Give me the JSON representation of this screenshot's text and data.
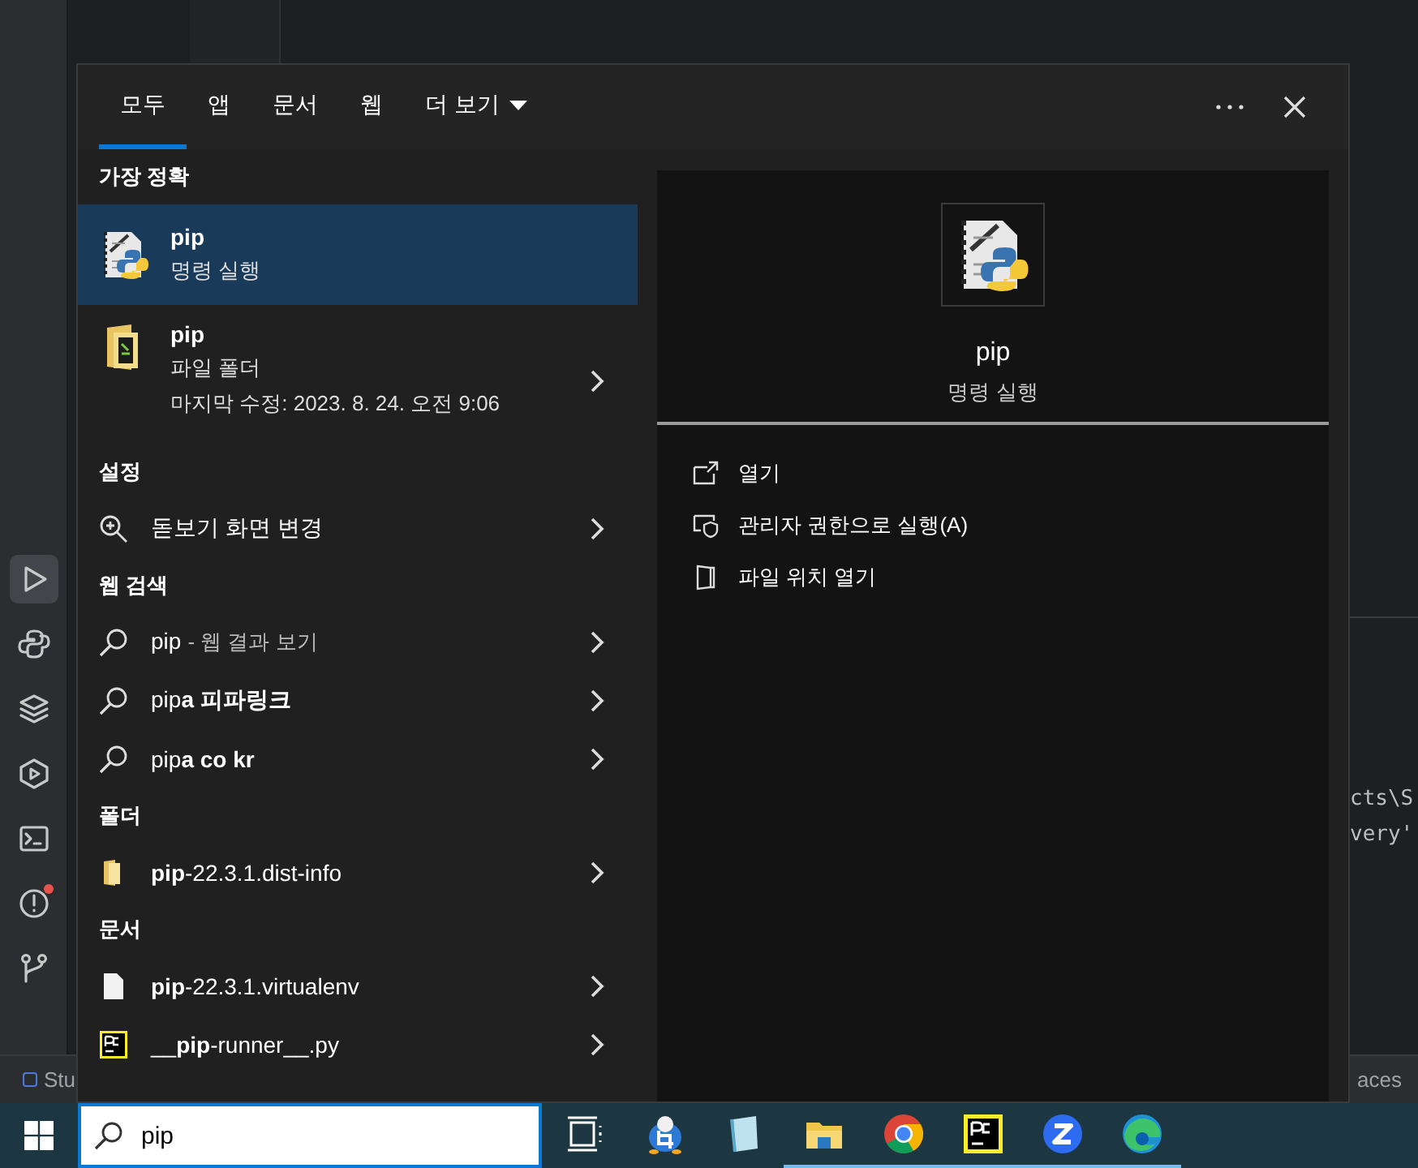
{
  "ide": {
    "activity_icons": [
      {
        "kind": "run",
        "selected": true,
        "notification": false
      },
      {
        "kind": "python",
        "selected": false,
        "notification": false
      },
      {
        "kind": "layers",
        "selected": false,
        "notification": false
      },
      {
        "kind": "services",
        "selected": false,
        "notification": false
      },
      {
        "kind": "terminal",
        "selected": false,
        "notification": false
      },
      {
        "kind": "problems",
        "selected": false,
        "notification": true
      },
      {
        "kind": "git",
        "selected": false,
        "notification": false
      }
    ],
    "code_lines": [
      "cts\\S",
      "very'"
    ],
    "status_left": "Stu",
    "status_right": "aces"
  },
  "search": {
    "tabs": [
      {
        "label": "모두",
        "selected": true,
        "dropdown": false
      },
      {
        "label": "앱",
        "selected": false,
        "dropdown": false
      },
      {
        "label": "문서",
        "selected": false,
        "dropdown": false
      },
      {
        "label": "웹",
        "selected": false,
        "dropdown": false
      },
      {
        "label": "더 보기",
        "selected": false,
        "dropdown": true
      }
    ],
    "sections": [
      {
        "heading": "가장 정확",
        "items": [
          {
            "kind": "command",
            "title": "pip",
            "subtitle": "명령 실행",
            "selected": true
          }
        ]
      },
      {
        "items": [
          {
            "kind": "folder",
            "title": "pip",
            "subtitle": "파일 폴더",
            "detail": "마지막 수정: 2023. 8. 24. 오전 9:06",
            "selected": false
          }
        ]
      },
      {
        "heading": "설정",
        "items": [
          {
            "kind": "setting",
            "text": "돋보기 화면 변경",
            "selected": false
          }
        ]
      },
      {
        "heading": "웹 검색",
        "items": [
          {
            "kind": "web",
            "text": "pip",
            "hint": "- 웹 결과 보기",
            "selected": false
          },
          {
            "kind": "web",
            "text": "pip**a 피파링크**",
            "selected": false
          },
          {
            "kind": "web",
            "text": "pip**a co kr**",
            "selected": false
          }
        ]
      },
      {
        "heading": "폴더",
        "items": [
          {
            "kind": "subfolder",
            "text": "**pip**-22.3.1.dist-info",
            "selected": false
          }
        ]
      },
      {
        "heading": "문서",
        "items": [
          {
            "kind": "document",
            "text": "**pip**-22.3.1.virtualenv",
            "selected": false
          },
          {
            "kind": "python-file",
            "text": "__**pip**-runner__.py",
            "selected": false
          }
        ]
      }
    ],
    "preview": {
      "title": "pip",
      "subtitle": "명령 실행",
      "actions": [
        {
          "kind": "open",
          "label": "열기"
        },
        {
          "kind": "admin",
          "label": "관리자 권한으로 실행(A)"
        },
        {
          "kind": "location",
          "label": "파일 위치 열기"
        }
      ]
    }
  },
  "taskbar": {
    "search": {
      "value": "pip"
    },
    "apps": [
      {
        "kind": "taskview",
        "running": false
      },
      {
        "kind": "capture",
        "running": false
      },
      {
        "kind": "notepad",
        "running": false
      },
      {
        "kind": "explorer",
        "running": true
      },
      {
        "kind": "chrome",
        "running": true
      },
      {
        "kind": "pycharm",
        "running": true
      },
      {
        "kind": "zoom",
        "running": true
      },
      {
        "kind": "edge",
        "running": true
      }
    ]
  }
}
